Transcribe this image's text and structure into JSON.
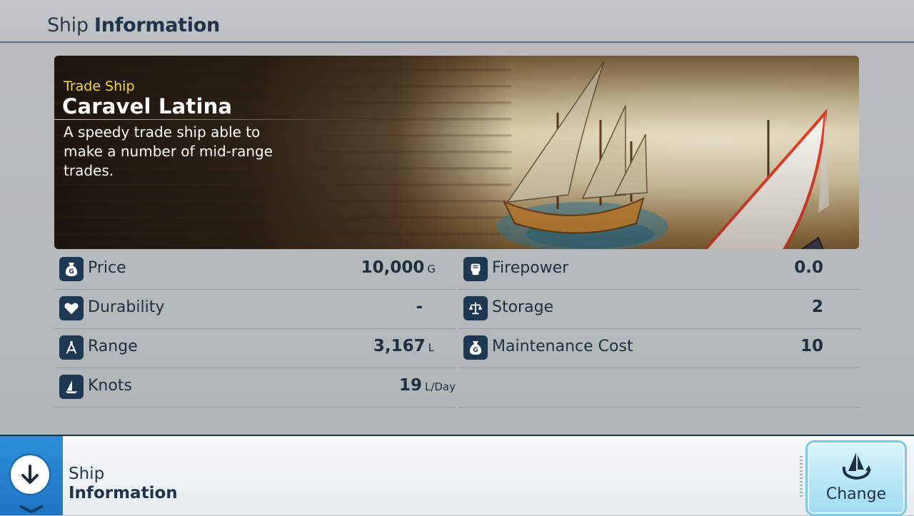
{
  "header": {
    "title_prefix": "Ship",
    "title_bold": "Information"
  },
  "ship": {
    "type": "Trade Ship",
    "name": "Caravel Latina",
    "description": "A speedy trade ship able to make a number of mid-range trades."
  },
  "stats_left": [
    {
      "icon": "money-bag-icon",
      "label": "Price",
      "value": "10,000",
      "unit": "G"
    },
    {
      "icon": "heart-icon",
      "label": "Durability",
      "value": "-",
      "unit": ""
    },
    {
      "icon": "compass-icon",
      "label": "Range",
      "value": "3,167",
      "unit": "L"
    },
    {
      "icon": "sail-icon",
      "label": "Knots",
      "value": "19",
      "unit": "L/Day"
    }
  ],
  "stats_right": [
    {
      "icon": "fist-icon",
      "label": "Firepower",
      "value": "0.0",
      "unit": ""
    },
    {
      "icon": "scales-icon",
      "label": "Storage",
      "value": "2",
      "unit": ""
    },
    {
      "icon": "money-bag-icon",
      "label": "Maintenance Cost",
      "value": "10",
      "unit": ""
    }
  ],
  "footer": {
    "title_top": "Ship",
    "title_bold": "Information",
    "change_label": "Change"
  },
  "colors": {
    "accent_blue": "#1d74c2",
    "icon_bg": "#1f3852",
    "ship_type_yellow": "#f5d742",
    "change_bg": "#9fdaf0"
  }
}
